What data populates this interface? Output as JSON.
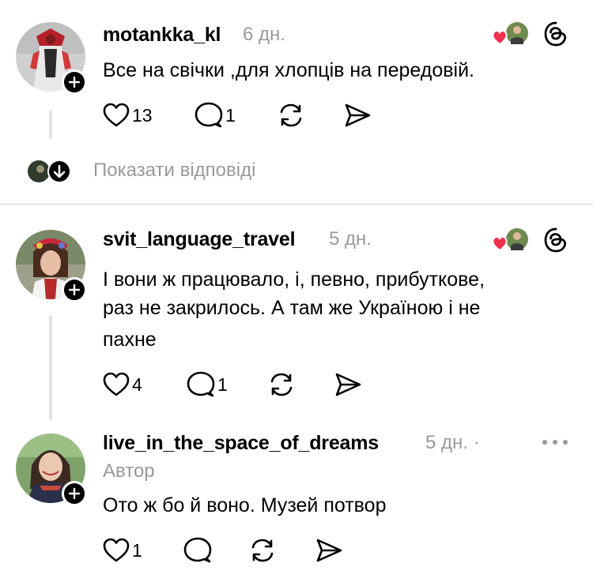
{
  "icons": {
    "like": "heart-outline-icon",
    "reply": "speech-bubble-icon",
    "repost": "repost-arrows-icon",
    "share": "send-arrow-icon",
    "add": "plus-icon",
    "threads": "threads-logo-icon",
    "liked_by_author": "red-heart-icon",
    "show_replies": "arrow-down-icon",
    "more": "more-dots-icon"
  },
  "colors": {
    "heart": "#f0304f",
    "muted": "#999999"
  },
  "posts": [
    {
      "username": "motankka_kl",
      "age": "6 дн.",
      "text": [
        "Все на свічки ,для хлопців на передовій."
      ],
      "likes": "13",
      "replies": "1"
    },
    {
      "username": "svit_language_travel",
      "age": "5 дн.",
      "text": [
        "І вони ж працювало, і, певно, прибуткове,",
        "раз не закрилось. А там же Україною і не",
        "пахне"
      ],
      "likes": "4",
      "replies": "1"
    },
    {
      "username": "live_in_the_space_of_dreams",
      "age": "5 дн. ·",
      "author_label": "Автор",
      "text": [
        "Ото ж бо й воно. Музей потвор"
      ],
      "likes": "1"
    }
  ],
  "show_replies_label": "Показати відповіді"
}
